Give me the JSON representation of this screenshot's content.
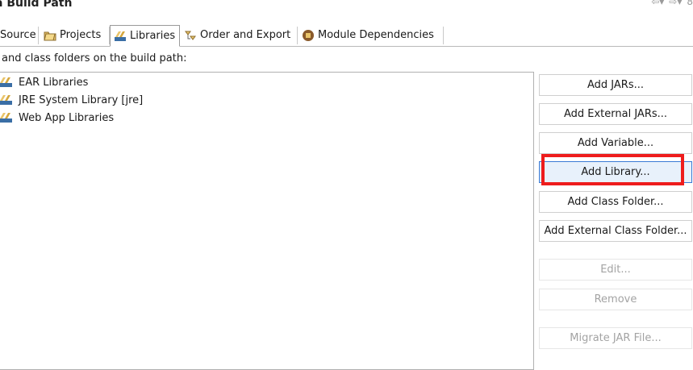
{
  "window": {
    "title": "a Build Path"
  },
  "tabs": [
    {
      "label": "Source",
      "icon": "source-icon",
      "selected": false
    },
    {
      "label": "Projects",
      "icon": "folder-icon",
      "selected": false
    },
    {
      "label": "Libraries",
      "icon": "library-icon",
      "selected": true
    },
    {
      "label": "Order and Export",
      "icon": "order-export-icon",
      "selected": false
    },
    {
      "label": "Module Dependencies",
      "icon": "module-icon",
      "selected": false
    }
  ],
  "description": "ts and class folders on the build path:",
  "libraries": [
    {
      "label": "EAR Libraries",
      "icon": "library-icon"
    },
    {
      "label": "JRE System Library [jre]",
      "icon": "library-icon"
    },
    {
      "label": "Web App Libraries",
      "icon": "library-icon"
    }
  ],
  "buttons": {
    "add_jars": "Add JARs...",
    "add_external_jars": "Add External JARs...",
    "add_variable": "Add Variable...",
    "add_library": "Add Library...",
    "add_class_folder": "Add Class Folder...",
    "add_external_class_folder": "Add External Class Folder...",
    "edit": "Edit...",
    "remove": "Remove",
    "migrate_jar": "Migrate JAR File..."
  },
  "colors": {
    "highlight": "#ee1c1c",
    "focus": "#3a7bd5"
  }
}
